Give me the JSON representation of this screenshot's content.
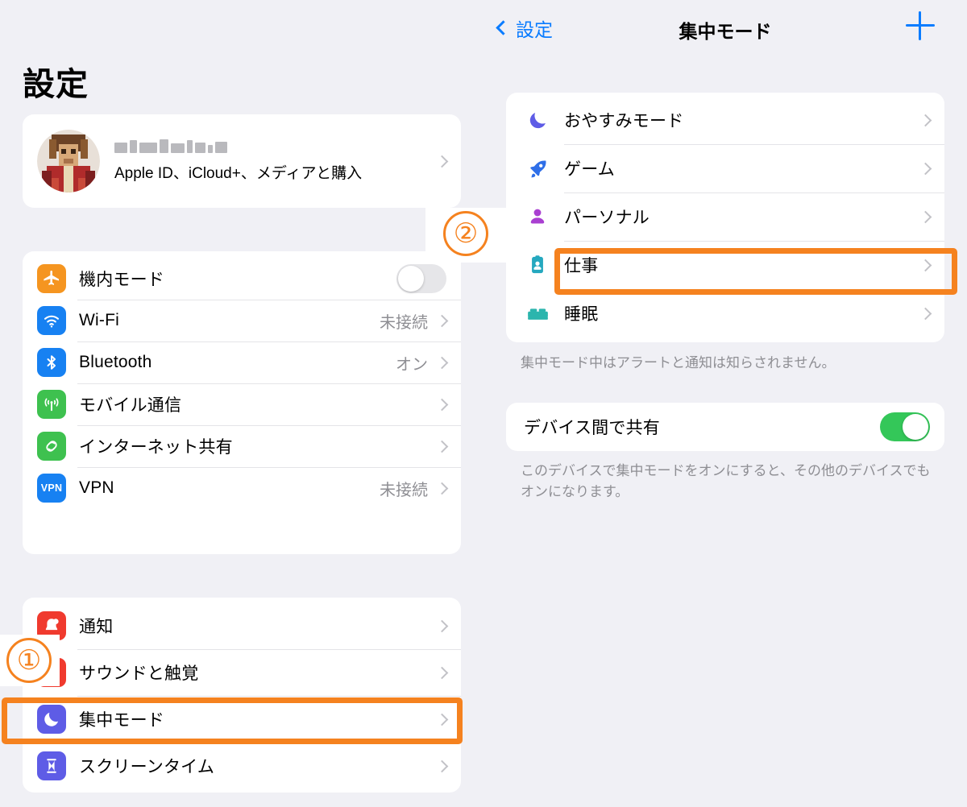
{
  "colors": {
    "background": "#f0f0f5",
    "card": "#ffffff",
    "accent_blue": "#0a7cff",
    "highlight_orange": "#f5821f",
    "toggle_on_green": "#34c759",
    "toggle_off_gray": "#e6e6e9",
    "secondary_text": "#8e8e93"
  },
  "left_pane": {
    "page_title": "設定",
    "account": {
      "name_redacted": true,
      "subtitle": "Apple ID、iCloud+、メディアと購入",
      "avatar_icon": "user-avatar-pixelated",
      "chevron_icon": "chevron-right-icon"
    },
    "network_section": {
      "items": [
        {
          "label": "機内モード",
          "icon": "airplane-icon",
          "icon_bg": "#f59520",
          "control": "toggle",
          "toggle_on": false
        },
        {
          "label": "Wi-Fi",
          "icon": "wifi-icon",
          "icon_bg": "#1781f2",
          "control": "value",
          "value": "未接続"
        },
        {
          "label": "Bluetooth",
          "icon": "bluetooth-icon",
          "icon_bg": "#1781f2",
          "control": "value",
          "value": "オン"
        },
        {
          "label": "モバイル通信",
          "icon": "cellular-icon",
          "icon_bg": "#3ec14f",
          "control": "value",
          "value": ""
        },
        {
          "label": "インターネット共有",
          "icon": "hotspot-icon",
          "icon_bg": "#3ec14f",
          "control": "value",
          "value": ""
        },
        {
          "label": "VPN",
          "icon": "vpn-icon",
          "icon_bg": "#1781f2",
          "control": "value",
          "value": "未接続"
        }
      ]
    },
    "notification_section": {
      "items": [
        {
          "label": "通知",
          "icon": "notification-bell-icon",
          "icon_bg": "#f03a2e"
        },
        {
          "label": "サウンドと触覚",
          "icon": "sound-haptics-icon",
          "icon_bg": "#f03a2e"
        },
        {
          "label": "集中モード",
          "icon": "focus-moon-icon",
          "icon_bg": "#5e5ce6",
          "highlighted": true
        },
        {
          "label": "スクリーンタイム",
          "icon": "hourglass-icon",
          "icon_bg": "#5e5ce6"
        }
      ]
    }
  },
  "right_pane": {
    "navbar": {
      "back_label": "設定",
      "back_icon": "chevron-left-icon",
      "title": "集中モード",
      "add_icon": "plus-icon"
    },
    "focus_section": {
      "items": [
        {
          "label": "おやすみモード",
          "icon": "moon-icon",
          "icon_color": "#5e5ce6"
        },
        {
          "label": "ゲーム",
          "icon": "rocket-icon",
          "icon_color": "#2f6fe8"
        },
        {
          "label": "パーソナル",
          "icon": "person-icon",
          "icon_color": "#a93fd1"
        },
        {
          "label": "仕事",
          "icon": "id-badge-icon",
          "icon_color": "#25a8bf",
          "highlighted": true
        },
        {
          "label": "睡眠",
          "icon": "bed-icon",
          "icon_color": "#2bb5ad"
        }
      ],
      "footnote": "集中モード中はアラートと通知は知らされません。"
    },
    "share_section": {
      "label": "デバイス間で共有",
      "toggle_on": true,
      "footnote": "このデバイスで集中モードをオンにすると、その他のデバイスでもオンになります。"
    }
  },
  "annotations": {
    "badge_1": "①",
    "badge_2": "②"
  }
}
